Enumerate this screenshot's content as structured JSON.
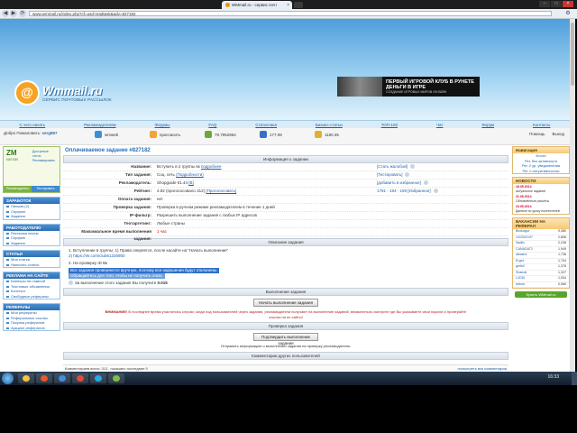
{
  "browser": {
    "tab_title": "WMmail.ru - сервис почт",
    "tab_close": "×",
    "window_buttons": [
      "–",
      "□",
      "×"
    ],
    "nav": [
      "◀",
      "▶",
      "⟳"
    ],
    "url": "www.wmmail.ru/index.php?cf=usd-readtask&adv=827182",
    "menu_icon": "wrench-icon"
  },
  "header": {
    "logo_badge": "@",
    "logo_title": "Wmmail.ru",
    "logo_sub": "СЕРВИС ПОЧТОВЫХ РАССЫЛОК",
    "banner_title": "ПЕРВЫЙ ИГРОВОЙ КЛУБ В РУНЕТЕ",
    "banner_line2": "ДЕНЬГИ В ИГРЕ",
    "banner_sub": "СОЗДАНИЕ ИГРОВЫХ МИРОВ ОНЛАЙН"
  },
  "menu": [
    "С чего начать",
    "Рекламодателям",
    "Форумы",
    "FAQ",
    "Статистика",
    "Бизнес-статьи",
    "ТОП-100",
    "Чат",
    "Форум",
    "Контакты"
  ],
  "userbar": {
    "greeting": "Добро Пожаловать:",
    "username": "serg867",
    "stats": [
      {
        "label": "wmweb",
        "color": "#3b8fd6"
      },
      {
        "label": "пригласить",
        "color": "#f2a33a"
      },
      {
        "label": "79.7952964",
        "color": "#6aa83a"
      },
      {
        "label": "177.08",
        "color": "#3b6fc2"
      },
      {
        "label": "1180.35",
        "color": "#e0b030"
      }
    ],
    "right": [
      "Помощь",
      "Выход"
    ]
  },
  "left": {
    "zm_logo": "ZM",
    "zm_sub": "NATION",
    "zm_links": [
      "Доступные",
      "тесты",
      "Рекламировать"
    ],
    "zm_tabs": [
      "Рекомендатель",
      "Тестировать"
    ],
    "panels": [
      {
        "title": "ЗАРАБОТОК",
        "items": [
          "Письма (2)",
          "Серфинг",
          "Задания"
        ]
      },
      {
        "title": "РАБОТОДАТЕЛЮ",
        "items": [
          "Рассылка писем",
          "Серфинг",
          "Задания"
        ]
      },
      {
        "title": "СТАТЬИ",
        "items": [
          "Мои статьи",
          "Написать статью"
        ]
      },
      {
        "title": "РЕКЛАМА НА САЙТЕ",
        "items": [
          "Баннеры на главной",
          "Текстовые объявления",
          "Контекст",
          "Свободные рефералы"
        ]
      },
      {
        "title": "РЕФЕРАЛЫ",
        "items": [
          "Мои рефералы",
          "Реферальные ссылки",
          "Покупка рефералов",
          "Аукцион рефералов"
        ]
      }
    ]
  },
  "main": {
    "title": "Оплачиваемое задание #827182",
    "info_header": "Информация о задании",
    "rows": [
      {
        "label": "Название:",
        "value": "Вступить в 2 группы вк",
        "link": "подробнее",
        "right": "[Стать жалобой]"
      },
      {
        "label": "Тип задания:",
        "value": "Соц. сеть",
        "link": "(Подробности)",
        "right": "[Тестировать]"
      },
      {
        "label": "Рекламодатель:",
        "value": "Shopguide 61.44",
        "link": "[В]",
        "right": "[добавить в избранное]"
      },
      {
        "label": "Рейтинг:",
        "value": "4.92 (проголосовало 312)",
        "link": "[Проголосовать]",
        "right": "1781 - 194 - 159  [Избранное]"
      },
      {
        "label": "Оплата задания:",
        "value": "нет",
        "link": "",
        "right": ""
      },
      {
        "label": "Проверка задания:",
        "value": "Проверка в ручном режиме рекламодателем в течение 1 дней",
        "link": "",
        "right": ""
      },
      {
        "label": "IP-фильтр:",
        "value": "Разрешить выполнение задания с любых IP адресов",
        "link": "",
        "right": ""
      },
      {
        "label": "Геотаргетинг:",
        "value": "Любые страны",
        "link": "",
        "right": ""
      },
      {
        "label": "Максимальное время выполнения задания:",
        "value": "1 час",
        "link": "",
        "right": ""
      }
    ],
    "desc_header": "Описание задания",
    "desc_lines": [
      "1. Вступление в группы: 1) Права оперяется, после касайте на \"Начать выполнение\"",
      "2) https://vk.com/club61226950"
    ],
    "desc_line3": "2. На проверку ID Вк",
    "desc_hl1": "Все задания проверяются вручную, поэтому все нарушения будут отклонены.",
    "desc_hl2": "Обращайтесь для того, чтобы не получить отказ.",
    "done_text": "За выполнение этого задания Вы получите",
    "done_sum": "0.015",
    "exec_header": "Выполнение задания",
    "start_btn": "Начать выполнение задания",
    "warn_label": "ВНИМАНИЕ!",
    "warn_text": "В последнее время участились случаи, когда под пользователей через задания, рекламодатели получают на выполнение заданий, внимательно смотрите где Вы указываете свои пароли и проверяйте ссылки на их сайты!",
    "check_header": "Проверка задания",
    "confirm_btn": "Подтвердить выполнение задания",
    "check_note": "Отправить информацию о выполнении задания на проверку рекламодателю.",
    "comments_header": "Комментарии других пользователей",
    "status_left": "Комментариев всего: 313 , показано последние 5",
    "status_right": "посмотреть все комментарии"
  },
  "right": {
    "box1_title": "Навигация",
    "box1_links": [
      "Блоги",
      "Рег. без активности",
      "Рег. 2 ур. уведомления",
      "Рег. с интуитивностью"
    ],
    "news_title": "НОВОСТИ",
    "news": [
      {
        "date": "18.05.2014",
        "text": "Актуальное задание"
      },
      {
        "date": "21.05.2014",
        "text": "Обновлённые расчёты"
      },
      {
        "date": "23.05.2014",
        "text": "Данные по уроку посетителей"
      }
    ],
    "rank_title": "ВАКАНСИИ НА РЕФЕРАЛ",
    "ranks": [
      {
        "n": "Birdudgur",
        "v": "9,380"
      },
      {
        "n": "CK2002197",
        "v": "2,896"
      },
      {
        "n": "Sadfix",
        "v": "2,238"
      },
      {
        "n": "CANADAT2",
        "v": "1,949"
      },
      {
        "n": "alkashd",
        "v": "1,736"
      },
      {
        "n": "Ergex",
        "v": "1,704"
      },
      {
        "n": "gertk2",
        "v": "1,378"
      },
      {
        "n": "Shamal",
        "v": "1,327"
      },
      {
        "n": "L3GDI",
        "v": "1,004"
      },
      {
        "n": "rbibob",
        "v": "0,960"
      }
    ],
    "green_btn": "Купить WMmail.ru"
  },
  "taskbar": {
    "clock": "16:33",
    "icons": [
      {
        "name": "explorer-icon",
        "color": "#f6c342"
      },
      {
        "name": "media-icon",
        "color": "#e45b2c"
      },
      {
        "name": "player-icon",
        "color": "#3f8fe0"
      },
      {
        "name": "chrome-icon",
        "color": "#e64a3b"
      },
      {
        "name": "skype-icon",
        "color": "#2aa8e8"
      },
      {
        "name": "app-icon",
        "color": "#7bc043"
      }
    ]
  }
}
